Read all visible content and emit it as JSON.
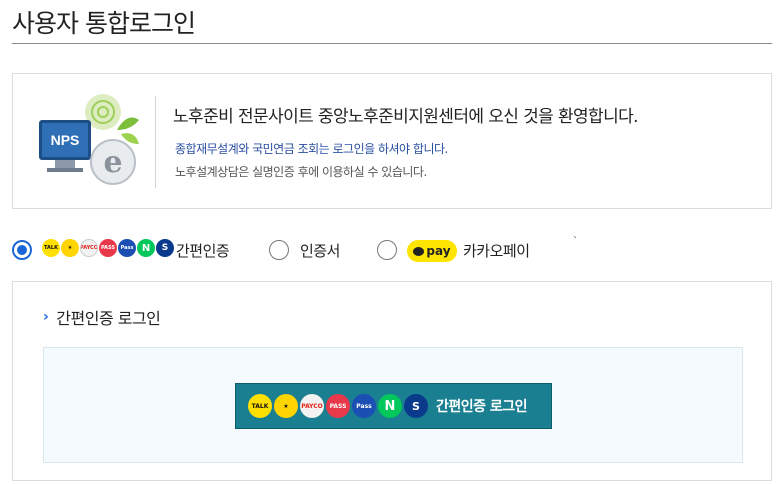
{
  "header": {
    "title": "사용자 통합로그인"
  },
  "welcome": {
    "main": "노후준비 전문사이트 중앙노후준비지원센터에 오신 것을 환영합니다.",
    "sub1": "종합재무설계와 국민연금 조회는 로그인을 하셔야 합니다.",
    "sub2": "노후설계상담은 실명인증 후에 이용하실 수 있습니다.",
    "logo_text": "NPS"
  },
  "methods": [
    {
      "label": "간편인증",
      "selected": true
    },
    {
      "label": "인증서",
      "selected": false
    },
    {
      "label": "카카오페이",
      "selected": false,
      "badge": "pay"
    }
  ],
  "mark": "`",
  "providers": [
    {
      "name": "kakao",
      "text": "TALK",
      "color": "#ffe000"
    },
    {
      "name": "toss",
      "text": "★",
      "color": "#ffd400"
    },
    {
      "name": "payco",
      "text": "PAYCO",
      "color": "#f2f2f2"
    },
    {
      "name": "pass",
      "text": "PASS",
      "color": "#e8394a"
    },
    {
      "name": "samsung-pass",
      "text": "Pass",
      "color": "#1b4fb3"
    },
    {
      "name": "naver",
      "text": "N",
      "color": "#03c75a"
    },
    {
      "name": "shinhan",
      "text": "S",
      "color": "#0a3a8c"
    }
  ],
  "panel": {
    "title": "간편인증 로그인",
    "button_label": "간편인증 로그인"
  },
  "colors": {
    "accent": "#1a66d6",
    "button": "#1a7f91"
  }
}
